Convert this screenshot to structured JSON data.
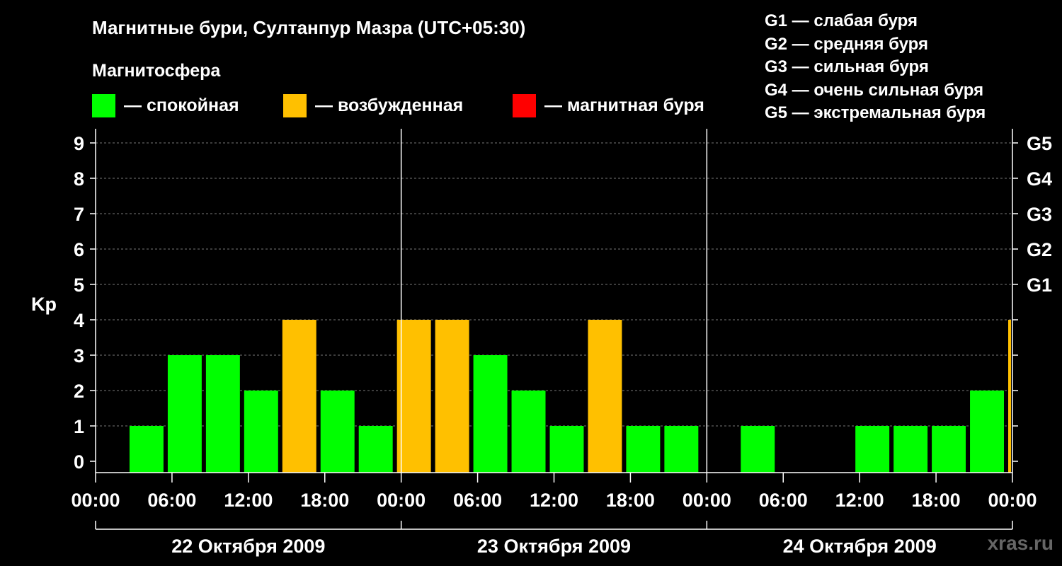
{
  "title": "Магнитные бури, Султанпур Мазра (UTC+05:30)",
  "magnetosphere": {
    "title": "Магнитосфера",
    "items": [
      {
        "label": "— спокойная",
        "color": "#00ff00"
      },
      {
        "label": "— возбужденная",
        "color": "#ffc000"
      },
      {
        "label": "— магнитная буря",
        "color": "#ff0000"
      }
    ]
  },
  "storm_levels": [
    "G1 — слабая буря",
    "G2 — средняя буря",
    "G3 — сильная буря",
    "G4 — очень сильная буря",
    "G5 — экстремальная буря"
  ],
  "watermark": "xras.ru",
  "chart_data": {
    "type": "bar",
    "ylabel": "Kp",
    "ylim": [
      0,
      9
    ],
    "yticks": [
      0,
      1,
      2,
      3,
      4,
      5,
      6,
      7,
      8,
      9
    ],
    "right_ticks": [
      {
        "value": 5,
        "label": "G1"
      },
      {
        "value": 6,
        "label": "G2"
      },
      {
        "value": 7,
        "label": "G3"
      },
      {
        "value": 8,
        "label": "G4"
      },
      {
        "value": 9,
        "label": "G5"
      }
    ],
    "grid": true,
    "colors": {
      "quiet": "#00ff00",
      "disturbed": "#ffc000",
      "storm": "#ff0000"
    },
    "x_tick_labels": [
      "00:00",
      "06:00",
      "12:00",
      "18:00",
      "00:00",
      "06:00",
      "12:00",
      "18:00",
      "00:00",
      "06:00",
      "12:00",
      "18:00",
      "00:00"
    ],
    "days": [
      "22 Октября 2009",
      "23 Октября 2009",
      "24 Октября 2009"
    ],
    "series": [
      {
        "values": [
          {
            "start": "22 Oct 2009 02:30",
            "kp": 1
          },
          {
            "start": "22 Oct 2009 05:30",
            "kp": 3
          },
          {
            "start": "22 Oct 2009 08:30",
            "kp": 3
          },
          {
            "start": "22 Oct 2009 11:30",
            "kp": 2
          },
          {
            "start": "22 Oct 2009 14:30",
            "kp": 4
          },
          {
            "start": "22 Oct 2009 17:30",
            "kp": 2
          },
          {
            "start": "22 Oct 2009 20:30",
            "kp": 1
          },
          {
            "start": "22 Oct 2009 23:30",
            "kp": 4
          },
          {
            "start": "23 Oct 2009 02:30",
            "kp": 4
          },
          {
            "start": "23 Oct 2009 05:30",
            "kp": 3
          },
          {
            "start": "23 Oct 2009 08:30",
            "kp": 2
          },
          {
            "start": "23 Oct 2009 11:30",
            "kp": 1
          },
          {
            "start": "23 Oct 2009 14:30",
            "kp": 4
          },
          {
            "start": "23 Oct 2009 17:30",
            "kp": 1
          },
          {
            "start": "23 Oct 2009 20:30",
            "kp": 1
          },
          {
            "start": "23 Oct 2009 23:30",
            "kp": 0
          },
          {
            "start": "24 Oct 2009 02:30",
            "kp": 1
          },
          {
            "start": "24 Oct 2009 05:30",
            "kp": 0
          },
          {
            "start": "24 Oct 2009 08:30",
            "kp": 0
          },
          {
            "start": "24 Oct 2009 11:30",
            "kp": 1
          },
          {
            "start": "24 Oct 2009 14:30",
            "kp": 1
          },
          {
            "start": "24 Oct 2009 17:30",
            "kp": 1
          },
          {
            "start": "24 Oct 2009 20:30",
            "kp": 2
          },
          {
            "start": "24 Oct 2009 23:30",
            "kp": 4
          }
        ]
      }
    ]
  }
}
